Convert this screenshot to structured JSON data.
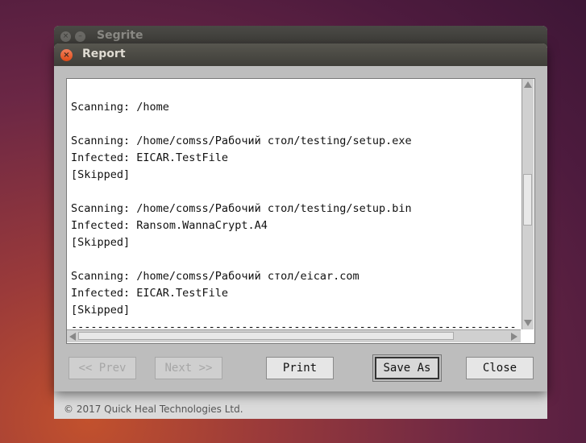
{
  "background_window": {
    "title": "Segrite",
    "copyright": "© 2017 Quick Heal Technologies Ltd."
  },
  "dialog": {
    "title": "Report",
    "report_text": "\nScanning: /home\n\nScanning: /home/comss/Рабочий стол/testing/setup.exe\nInfected: EICAR.TestFile\n[Skipped]\n\nScanning: /home/comss/Рабочий стол/testing/setup.bin\nInfected: Ransom.WannaCrypt.A4\n[Skipped]\n\nScanning: /home/comss/Рабочий стол/eicar.com\nInfected: EICAR.TestFile\n[Skipped]\n-----------------------------------------------------------------------------",
    "scroll": {
      "vertical_position": 0.5,
      "horizontal_visible_fraction": 0.85
    },
    "buttons": {
      "prev": "<< Prev",
      "next": "Next >>",
      "print": "Print",
      "save_as": "Save As",
      "close": "Close"
    }
  },
  "colors": {
    "titlebar": "#3f3e39",
    "close_button": "#df4a16",
    "dialog_bg": "#bdbdbd"
  }
}
